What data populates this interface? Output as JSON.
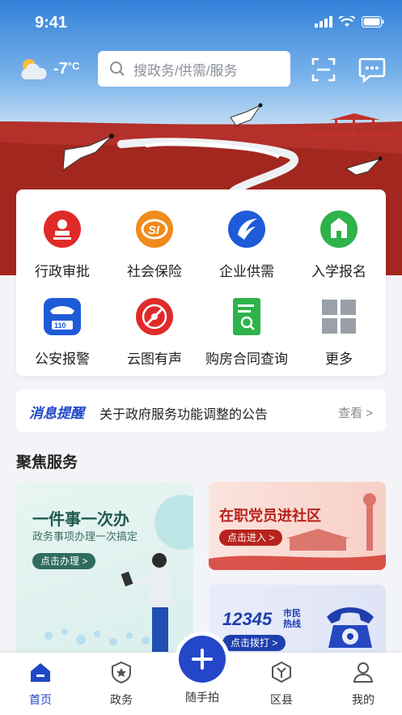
{
  "status_bar": {
    "time": "9:41"
  },
  "weather": {
    "temperature": "-7",
    "unit": "°C",
    "icon": "cloud-sun-icon"
  },
  "search": {
    "placeholder": "搜政务/供需/服务"
  },
  "services": [
    {
      "label": "行政审批",
      "icon": "approval-stamp-icon",
      "color": "#e02a2a"
    },
    {
      "label": "社会保险",
      "icon": "social-insurance-icon",
      "color": "#f28a1c"
    },
    {
      "label": "企业供需",
      "icon": "enterprise-wing-icon",
      "color": "#1f5bd8"
    },
    {
      "label": "入学报名",
      "icon": "school-enroll-icon",
      "color": "#2db34a"
    },
    {
      "label": "公安报警",
      "icon": "police-110-icon",
      "color": "#1f5bd8"
    },
    {
      "label": "云图有声",
      "icon": "cloud-audio-icon",
      "color": "#e02a2a"
    },
    {
      "label": "购房合同查询",
      "icon": "contract-search-icon",
      "color": "#2db34a"
    },
    {
      "label": "更多",
      "icon": "more-grid-icon",
      "color": "#9aa0a8"
    }
  ],
  "notice": {
    "tag": "消息提醒",
    "text": "关于政府服务功能调整的公告",
    "more": "查看 >"
  },
  "focus": {
    "title": "聚焦服务",
    "left_card": {
      "title": "一件事一次办",
      "subtitle": "政务事项办理一次搞定",
      "button": "点击办理 >"
    },
    "right_top": {
      "title": "在职党员进社区",
      "button": "点击进入 >"
    },
    "right_bottom": {
      "number": "12345",
      "hotline_1": "市民",
      "hotline_2": "热线",
      "button": "点击拨打 >"
    }
  },
  "tabbar": {
    "tabs": [
      {
        "label": "首页",
        "icon": "home-icon"
      },
      {
        "label": "政务",
        "icon": "government-star-icon"
      },
      {
        "label": "随手拍",
        "icon": "plus-icon"
      },
      {
        "label": "区县",
        "icon": "district-icon"
      },
      {
        "label": "我的",
        "icon": "user-icon"
      }
    ]
  },
  "colors": {
    "primary": "#1f47c7",
    "hero_red": "#b3302b",
    "sky": "#3d86df"
  }
}
